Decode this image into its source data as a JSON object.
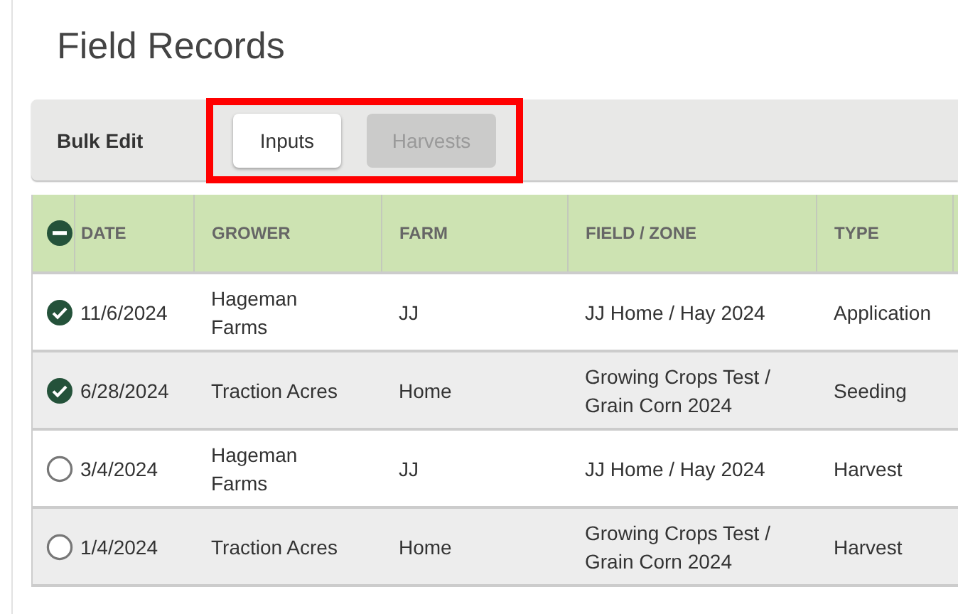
{
  "page_title": "Field Records",
  "toolbar": {
    "label": "Bulk Edit",
    "tabs": [
      {
        "label": "Inputs",
        "selected": true
      },
      {
        "label": "Harvests",
        "selected": false
      }
    ],
    "highlighted": true
  },
  "table": {
    "select_all": {
      "indeterminate": true
    },
    "columns": [
      "DATE",
      "GROWER",
      "FARM",
      "FIELD / ZONE",
      "TYPE"
    ],
    "rows": [
      {
        "checked": true,
        "cells": [
          "11/6/2024",
          "Hageman Farms",
          "JJ",
          "JJ Home / Hay 2024",
          "Application"
        ]
      },
      {
        "checked": true,
        "cells": [
          "6/28/2024",
          "Traction Acres",
          "Home",
          "Growing Crops Test / Grain Corn 2024",
          "Seeding"
        ]
      },
      {
        "checked": false,
        "cells": [
          "3/4/2024",
          "Hageman Farms",
          "JJ",
          "JJ Home / Hay 2024",
          "Harvest"
        ]
      },
      {
        "checked": false,
        "cells": [
          "1/4/2024",
          "Traction Acres",
          "Home",
          "Growing Crops Test / Grain Corn 2024",
          "Harvest"
        ]
      }
    ]
  }
}
